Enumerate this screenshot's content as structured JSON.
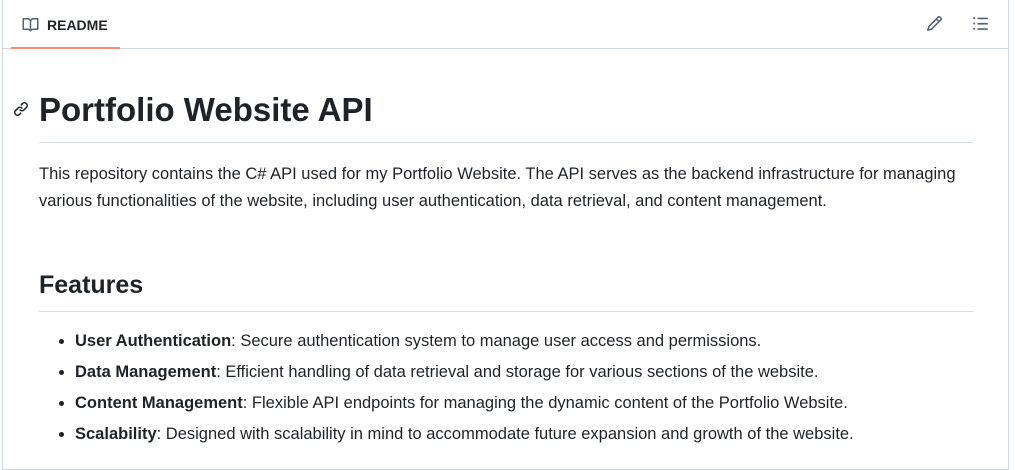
{
  "tab": {
    "label": "README",
    "icon": "book-icon"
  },
  "actions": {
    "edit_icon": "pencil-icon",
    "toc_icon": "list-icon"
  },
  "readme": {
    "title": "Portfolio Website API",
    "intro": "This repository contains the C# API used for my Portfolio Website. The API serves as the backend infrastructure for managing various functionalities of the website, including user authentication, data retrieval, and content management.",
    "features_heading": "Features",
    "features": [
      {
        "name": "User Authentication",
        "desc": ": Secure authentication system to manage user access and permissions."
      },
      {
        "name": "Data Management",
        "desc": ": Efficient handling of data retrieval and storage for various sections of the website."
      },
      {
        "name": "Content Management",
        "desc": ": Flexible API endpoints for managing the dynamic content of the Portfolio Website."
      },
      {
        "name": "Scalability",
        "desc": ": Designed with scalability in mind to accommodate future expansion and growth of the website."
      }
    ]
  },
  "colors": {
    "tab_underline": "#fd8c73",
    "text": "#1f2328",
    "icon": "#59636e",
    "border": "#d0d7de"
  }
}
